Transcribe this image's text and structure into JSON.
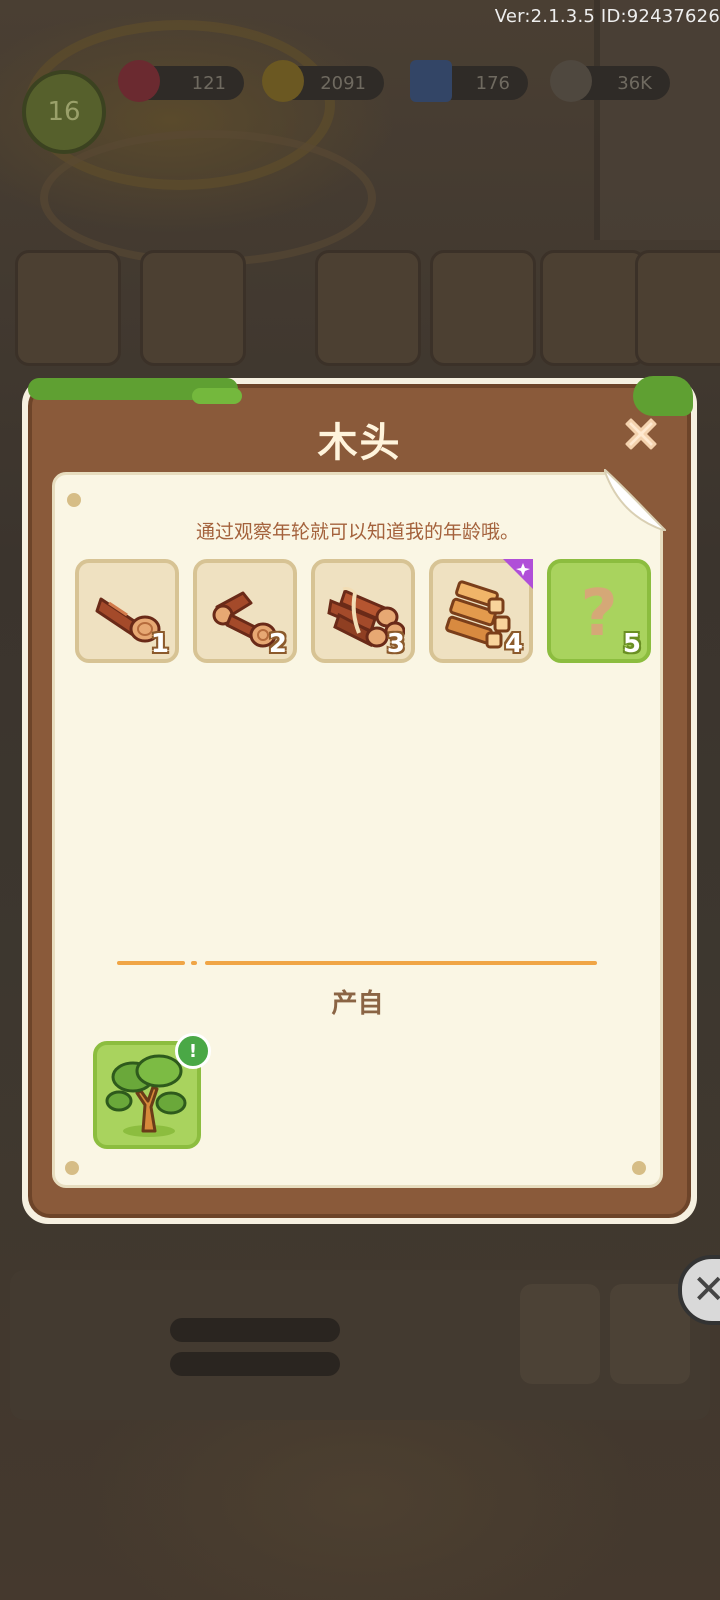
{
  "header": {
    "version_text": "Ver:2.1.3.5 ID:92437626",
    "level": "16",
    "resources": [
      {
        "name": "gem",
        "value": "121",
        "icon": "gem-icon",
        "color": "#7a3035"
      },
      {
        "name": "coin",
        "value": "2091",
        "icon": "coin-icon",
        "color": "#7d6424"
      },
      {
        "name": "energy",
        "value": "176",
        "icon": "lightning-icon",
        "color": "#3a4f7a"
      },
      {
        "name": "seed",
        "value": "36K",
        "icon": "seed-icon",
        "color": "#5d5448"
      }
    ]
  },
  "modal": {
    "title": "木头",
    "description": "通过观察年轮就可以知道我的年龄哦。",
    "items": [
      {
        "level": "1",
        "icon": "single-log-icon",
        "discovered": true
      },
      {
        "level": "2",
        "icon": "two-logs-icon",
        "discovered": true
      },
      {
        "level": "3",
        "icon": "tied-logs-icon",
        "discovered": true
      },
      {
        "level": "4",
        "icon": "plank-stack-icon",
        "discovered": true,
        "badge": "sparkle-badge-icon"
      },
      {
        "level": "5",
        "icon": "question-mark-icon",
        "discovered": false,
        "placeholder": "?"
      }
    ],
    "source_section_label": "产自",
    "sources": [
      {
        "icon": "tree-icon",
        "alert": "!"
      }
    ]
  },
  "colors": {
    "frame_brown": "#8a5a3a",
    "paper": "#faf6e4",
    "slot_tan": "#efe1c1",
    "slot_green": "#a9d35e",
    "divider_orange": "#f0a545",
    "badge_purple": "#b04fd8"
  }
}
